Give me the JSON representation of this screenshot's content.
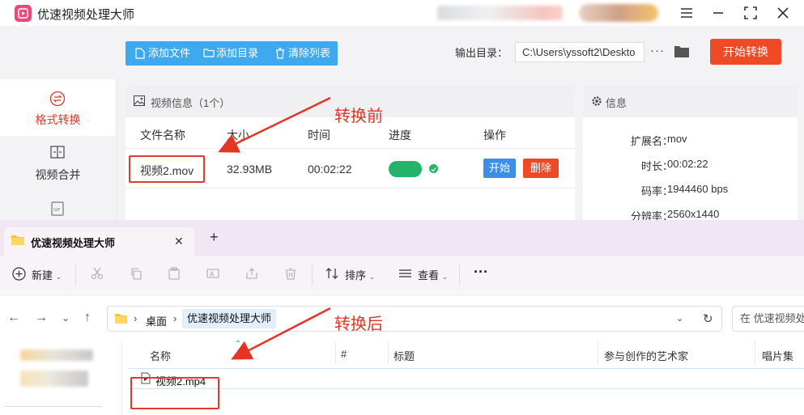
{
  "app": {
    "title": "优速视频处理大师",
    "sidebar": [
      {
        "label": "格式转换",
        "icon": "convert-icon"
      },
      {
        "label": "视频合并",
        "icon": "merge-icon"
      },
      {
        "label": "",
        "icon": "gif-icon"
      }
    ],
    "toolbar": {
      "add_file": "添加文件",
      "add_dir": "添加目录",
      "clear_list": "清除列表"
    },
    "output": {
      "label": "输出目录：",
      "path": "C:\\Users\\yssoft2\\Deskto",
      "more": "···"
    },
    "start_convert": "开始转换",
    "video_panel": {
      "title": "视频信息（1个）",
      "columns": [
        "文件名称",
        "大小",
        "时间",
        "进度",
        "操作"
      ],
      "row": {
        "name": "视频2.mov",
        "size": "32.93MB",
        "time": "00:02:22",
        "progress": 1.0,
        "btn_start": "开始",
        "btn_delete": "删除"
      }
    },
    "info_panel": {
      "title": "信息",
      "fields": [
        {
          "key": "扩展名：",
          "value": "mov"
        },
        {
          "key": "时长：",
          "value": "00:02:22"
        },
        {
          "key": "码率：",
          "value": "1944460 bps"
        },
        {
          "key": "分辨率：",
          "value": "2560x1440"
        }
      ]
    },
    "annotation_before": "转换前"
  },
  "explorer": {
    "tab_title": "优速视频处理大师",
    "commands": {
      "new": "新建",
      "sort": "排序",
      "view": "查看",
      "more": "···"
    },
    "breadcrumb": [
      "桌面",
      "优速视频处理大师"
    ],
    "search_placeholder": "在 优速视频处",
    "columns": [
      "名称",
      "#",
      "标题",
      "参与创作的艺术家",
      "唱片集"
    ],
    "file": "视频2.mp4",
    "annotation_after": "转换后"
  },
  "colors": {
    "accent_red": "#ef4a25",
    "toolbar_blue": "#3fa9f0",
    "progress_green": "#24b36b",
    "annotation_red": "#e43424"
  }
}
